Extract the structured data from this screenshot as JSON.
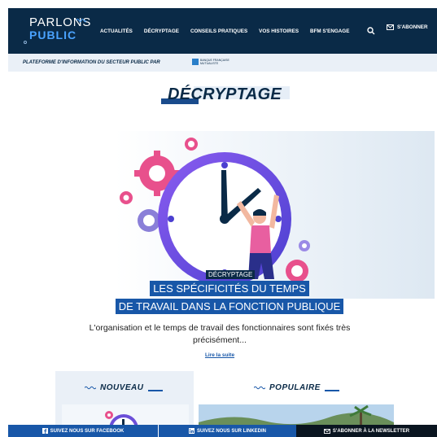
{
  "header": {
    "logo_line1": "PARLONS",
    "logo_line2": "PUBLIC",
    "nav": [
      "ACTUALITÉS",
      "DÉCRYPTAGE",
      "CONSEILS PRATIQUES",
      "VOS HISTOIRES",
      "BFM S'ENGAGE"
    ],
    "subscribe_label": "S'ABONNER",
    "search_icon": "search-icon",
    "subscribe_icon": "envelope-icon"
  },
  "platform": {
    "text": "PLATEFORME D'INFORMATION DU SECTEUR PUBLIC PAR",
    "partner_line1": "BANQUE FRANÇAISE",
    "partner_line2": "MUTUALISTE"
  },
  "page": {
    "title": "DÉCRYPTAGE"
  },
  "featured": {
    "tag": "DÉCRYPTAGE",
    "headline_line1": "LES SPÉCIFICITÉS DU TEMPS",
    "headline_line2": "DE TRAVAIL DANS LA FONCTION PUBLIQUE",
    "excerpt_line1": "L'organisation et le temps de travail des fonctionnaires sont fixés très",
    "excerpt_line2": "précisément...",
    "read_more": "Lire la suite"
  },
  "sections": {
    "nouveau": "NOUVEAU",
    "populaire": "POPULAIRE"
  },
  "bottom_bar": {
    "facebook": "SUIVEZ NOUS SUR FACEBOOK",
    "linkedin": "SUIVEZ NOUS SUR LINKEDIN",
    "newsletter": "S'ABONNER À LA NEWSLETTER"
  },
  "colors": {
    "navy": "#0a2a47",
    "accent_blue": "#1857a8",
    "light_blue": "#4aa3ff",
    "pale": "#eaf0f7",
    "pink": "#e8508c",
    "purple": "#6b4fd8"
  }
}
